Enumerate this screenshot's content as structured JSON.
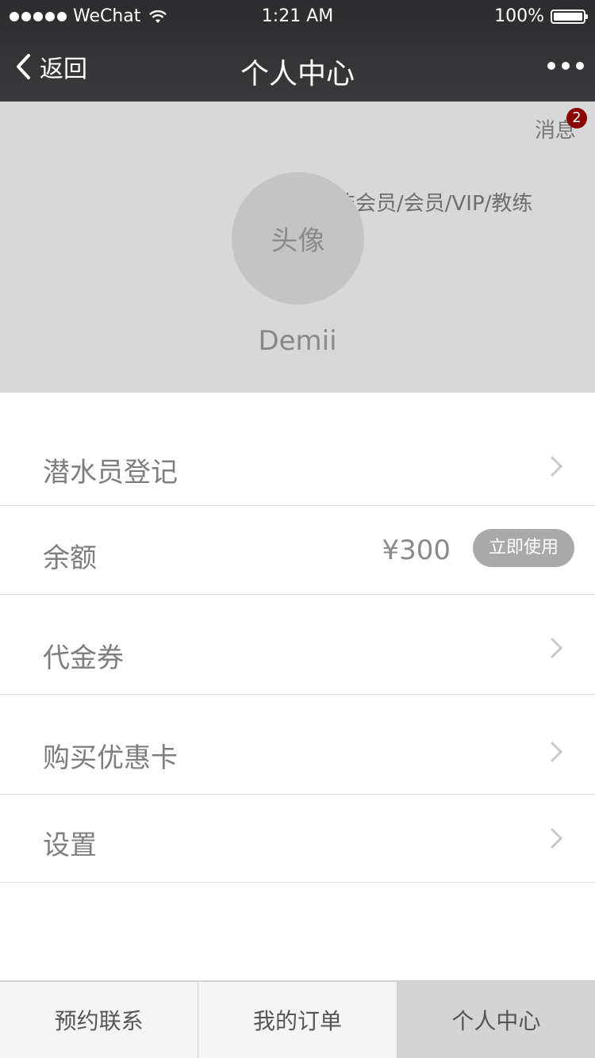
{
  "status_bar": {
    "carrier": "WeChat",
    "time": "1:21 AM",
    "battery": "100%"
  },
  "nav": {
    "back_label": "返回",
    "title": "个人中心"
  },
  "profile": {
    "messages_label": "消息",
    "messages_count": "2",
    "member_types": "非会员/会员/VIP/教练",
    "avatar_label": "头像",
    "username": "Demii"
  },
  "menu": {
    "diver_register": "潜水员登记",
    "balance_label": "余额",
    "balance_value": "¥300",
    "balance_action": "立即使用",
    "vouchers": "代金券",
    "buy_card": "购买优惠卡",
    "settings": "设置"
  },
  "tabs": [
    {
      "label": "预约联系"
    },
    {
      "label": "我的订单"
    },
    {
      "label": "个人中心"
    }
  ],
  "colors": {
    "nav_bg": "#333335",
    "header_bg": "#d8d8d8",
    "badge": "#8b0000",
    "button_bg": "#a9a9a9"
  }
}
